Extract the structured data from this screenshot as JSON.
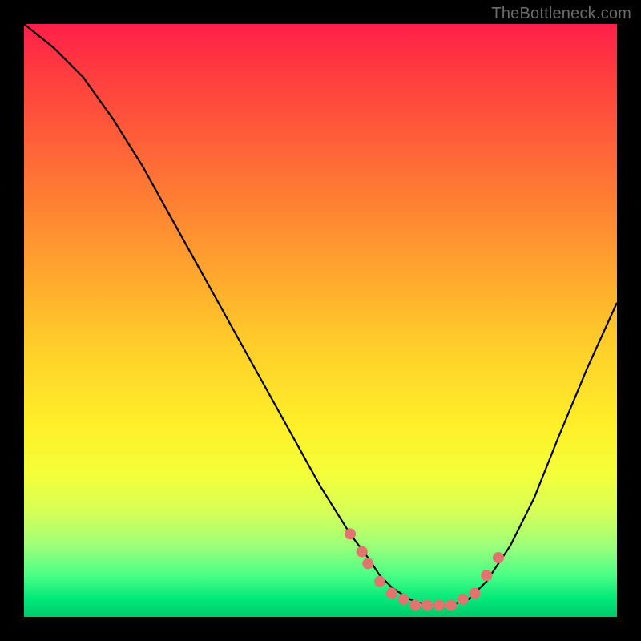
{
  "watermark": "TheBottleneck.com",
  "chart_data": {
    "type": "line",
    "title": "",
    "xlabel": "",
    "ylabel": "",
    "xlim": [
      0,
      100
    ],
    "ylim": [
      0,
      100
    ],
    "background_gradient": {
      "top": "#ff1f4a",
      "mid": "#ffd02a",
      "bottom": "#00c86a"
    },
    "series": [
      {
        "name": "bottleneck-curve",
        "x": [
          0,
          5,
          10,
          15,
          20,
          25,
          30,
          35,
          40,
          45,
          50,
          55,
          58,
          60,
          62,
          65,
          68,
          70,
          72,
          75,
          78,
          82,
          86,
          90,
          95,
          100
        ],
        "y": [
          100,
          96,
          91,
          84,
          76,
          67,
          58,
          49,
          40,
          31,
          22,
          14,
          10,
          7,
          5,
          3,
          2,
          2,
          2,
          3,
          6,
          12,
          20,
          30,
          42,
          53
        ]
      }
    ],
    "markers": {
      "name": "threshold-dots",
      "color": "#e2736f",
      "x": [
        55,
        57,
        58,
        60,
        62,
        64,
        66,
        68,
        70,
        72,
        74,
        76,
        78,
        80
      ],
      "y": [
        14,
        11,
        9,
        6,
        4,
        3,
        2,
        2,
        2,
        2,
        3,
        4,
        7,
        10
      ]
    }
  }
}
